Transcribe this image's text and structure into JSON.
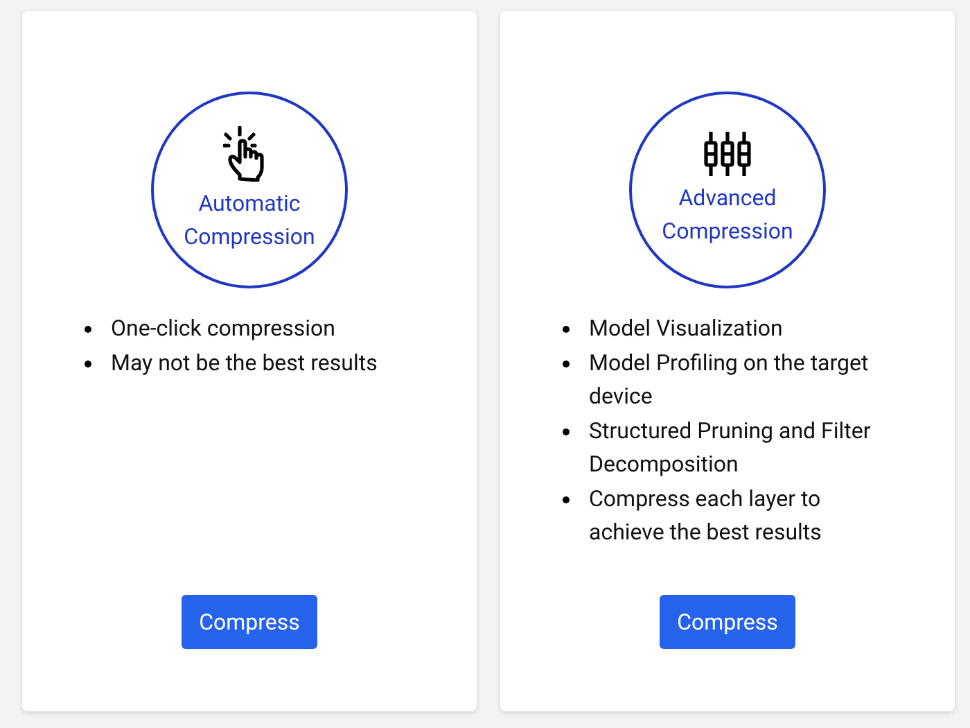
{
  "cards": [
    {
      "kind": "tap",
      "title_lines": [
        "Automatic",
        "Compression"
      ],
      "features": [
        "One-click compression",
        "May not be the best results"
      ],
      "button": "Compress"
    },
    {
      "kind": "sliders",
      "title_lines": [
        "Advanced",
        "Compression"
      ],
      "features": [
        "Model Visualization",
        "Model Profiling on the target device",
        "Structured Pruning and Filter Decomposition",
        "Compress each layer to achieve the best results"
      ],
      "button": "Compress"
    }
  ]
}
